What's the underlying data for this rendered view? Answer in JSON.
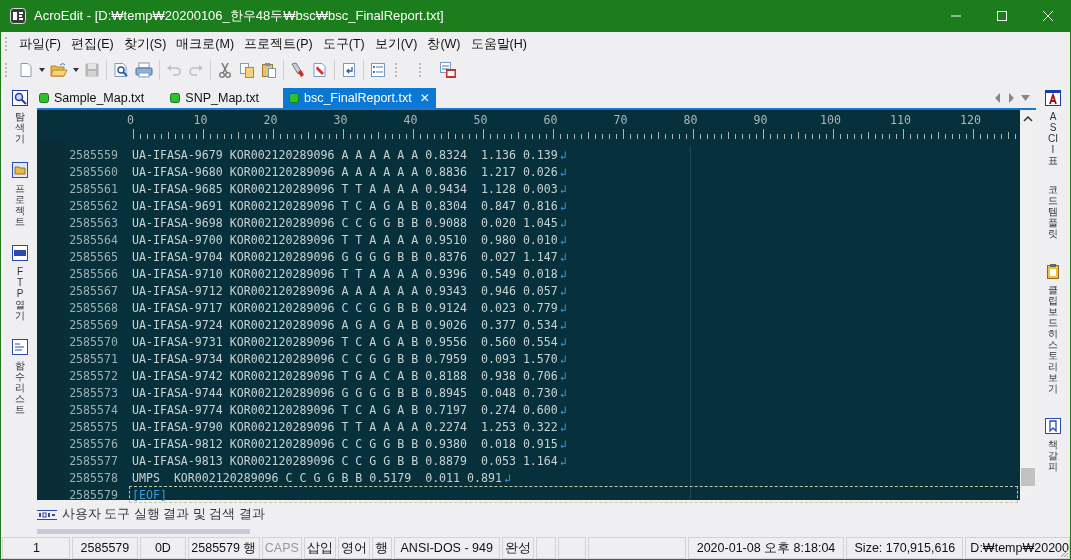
{
  "window": {
    "title": "AcroEdit - [D:₩temp₩20200106_한우48두₩bsc₩bsc_FinalReport.txt]"
  },
  "menu": [
    "파일(F)",
    "편집(E)",
    "찾기(S)",
    "매크로(M)",
    "프로젝트(P)",
    "도구(T)",
    "보기(V)",
    "창(W)",
    "도움말(H)"
  ],
  "toolbar": [
    {
      "kind": "new",
      "disabled": false
    },
    {
      "kind": "caret",
      "disabled": false
    },
    {
      "kind": "open",
      "disabled": false
    },
    {
      "kind": "caret",
      "disabled": false
    },
    {
      "kind": "save",
      "disabled": true
    },
    {
      "kind": "sep"
    },
    {
      "kind": "preview",
      "disabled": false
    },
    {
      "kind": "print",
      "disabled": false
    },
    {
      "kind": "sep"
    },
    {
      "kind": "undo",
      "disabled": true
    },
    {
      "kind": "redo",
      "disabled": true
    },
    {
      "kind": "sep"
    },
    {
      "kind": "cut",
      "disabled": false
    },
    {
      "kind": "copy",
      "disabled": false
    },
    {
      "kind": "paste",
      "disabled": false
    },
    {
      "kind": "sep"
    },
    {
      "kind": "marker",
      "disabled": false
    },
    {
      "kind": "eraser",
      "disabled": false
    },
    {
      "kind": "sep"
    },
    {
      "kind": "goto",
      "disabled": false
    },
    {
      "kind": "sep"
    },
    {
      "kind": "list",
      "disabled": false
    },
    {
      "kind": "grip"
    },
    {
      "kind": "grip"
    },
    {
      "kind": "calendar",
      "disabled": false
    }
  ],
  "left_panel": [
    {
      "kind": "search",
      "label": "탐색기"
    },
    {
      "kind": "folder",
      "label": "프로젝트"
    },
    {
      "kind": "ftp",
      "label": "FTP 열기"
    },
    {
      "kind": "chart",
      "label": "함수 리스트"
    }
  ],
  "right_panel": [
    {
      "kind": "ascii",
      "label": "ASCII 표"
    },
    {
      "kind": "none",
      "label": "코드 템플릿"
    },
    {
      "kind": "clipboard",
      "label": "클립보드 히스토리 보기"
    },
    {
      "kind": "bookmark",
      "label": "책갈피"
    }
  ],
  "tabs": [
    {
      "label": "Sample_Map.txt",
      "selected": false
    },
    {
      "label": "SNP_Map.txt",
      "selected": false
    },
    {
      "label": "bsc_FinalReport.txt",
      "selected": true,
      "close": "✕"
    }
  ],
  "ruler": [
    "0",
    "10",
    "20",
    "30",
    "40",
    "50",
    "60",
    "70",
    "80",
    "90",
    "100",
    "110",
    "120"
  ],
  "lines": [
    {
      "number": "2585559",
      "text": "UA-IFASA-9679 KOR002120289096 A A A A A A 0.8324  1.136 0.139",
      "eol": "↲",
      "current": false
    },
    {
      "number": "2585560",
      "text": "UA-IFASA-9680 KOR002120289096 A A A A A A 0.8836  1.217 0.026",
      "eol": "↲",
      "current": false
    },
    {
      "number": "2585561",
      "text": "UA-IFASA-9685 KOR002120289096 T T A A A A 0.9434  1.128 0.003",
      "eol": "↲",
      "current": false
    },
    {
      "number": "2585562",
      "text": "UA-IFASA-9691 KOR002120289096 T C A G A B 0.8304  0.847 0.816",
      "eol": "↲",
      "current": false
    },
    {
      "number": "2585563",
      "text": "UA-IFASA-9698 KOR002120289096 C C G G B B 0.9088  0.020 1.045",
      "eol": "↲",
      "current": false
    },
    {
      "number": "2585564",
      "text": "UA-IFASA-9700 KOR002120289096 T T A A A A 0.9510  0.980 0.010",
      "eol": "↲",
      "current": false
    },
    {
      "number": "2585565",
      "text": "UA-IFASA-9704 KOR002120289096 G G G G B B 0.8376  0.027 1.147",
      "eol": "↲",
      "current": false
    },
    {
      "number": "2585566",
      "text": "UA-IFASA-9710 KOR002120289096 T T A A A A 0.9396  0.549 0.018",
      "eol": "↲",
      "current": false
    },
    {
      "number": "2585567",
      "text": "UA-IFASA-9712 KOR002120289096 A A A A A A 0.9343  0.946 0.057",
      "eol": "↲",
      "current": false
    },
    {
      "number": "2585568",
      "text": "UA-IFASA-9717 KOR002120289096 C C G G B B 0.9124  0.023 0.779",
      "eol": "↲",
      "current": false
    },
    {
      "number": "2585569",
      "text": "UA-IFASA-9724 KOR002120289096 A G A G A B 0.9026  0.377 0.534",
      "eol": "↲",
      "current": false
    },
    {
      "number": "2585570",
      "text": "UA-IFASA-9731 KOR002120289096 T C A G A B 0.9556  0.560 0.554",
      "eol": "↲",
      "current": false
    },
    {
      "number": "2585571",
      "text": "UA-IFASA-9734 KOR002120289096 C C G G B B 0.7959  0.093 1.570",
      "eol": "↲",
      "current": false
    },
    {
      "number": "2585572",
      "text": "UA-IFASA-9742 KOR002120289096 T G A C A B 0.8188  0.938 0.706",
      "eol": "↲",
      "current": false
    },
    {
      "number": "2585573",
      "text": "UA-IFASA-9744 KOR002120289096 G G G G B B 0.8945  0.048 0.730",
      "eol": "↲",
      "current": false
    },
    {
      "number": "2585574",
      "text": "UA-IFASA-9774 KOR002120289096 T C A G A B 0.7197  0.274 0.600",
      "eol": "↲",
      "current": false
    },
    {
      "number": "2585575",
      "text": "UA-IFASA-9790 KOR002120289096 T T A A A A 0.2274  1.253 0.322",
      "eol": "↲",
      "current": false
    },
    {
      "number": "2585576",
      "text": "UA-IFASA-9812 KOR002120289096 C C G G B B 0.9380  0.018 0.915",
      "eol": "↲",
      "current": false
    },
    {
      "number": "2585577",
      "text": "UA-IFASA-9813 KOR002120289096 C C G G B B 0.8879  0.053 1.164",
      "eol": "↲",
      "current": false
    },
    {
      "number": "2585578",
      "text": "UMPS  KOR002120289096 C C G G B B 0.5179  0.011 0.891",
      "eol": "↲",
      "current": false
    },
    {
      "number": "2585579",
      "text": "[EOF]",
      "kind": "eof",
      "current": true
    }
  ],
  "output_panel": {
    "label": "사용자 도구 실행 결과 및 검색 결과"
  },
  "status_bar": [
    {
      "text": "1",
      "disabled": false
    },
    {
      "text": "2585579",
      "disabled": false
    },
    {
      "text": "0D",
      "disabled": false
    },
    {
      "text": "2585579 행",
      "disabled": false
    },
    {
      "text": "CAPS",
      "disabled": true
    },
    {
      "text": "삽입",
      "disabled": false
    },
    {
      "text": "영어",
      "disabled": false
    },
    {
      "text": "행",
      "disabled": false
    },
    {
      "text": "ANSI-DOS - 949",
      "disabled": false
    },
    {
      "text": "완성",
      "disabled": false
    },
    {
      "kind": "blank"
    },
    {
      "kind": "blank"
    },
    {
      "kind": "blank"
    },
    {
      "text": "2020-01-08 오후 8:18:04",
      "disabled": false
    },
    {
      "text": "Size: 170,915,616",
      "disabled": false
    },
    {
      "text": "D:₩temp₩20200",
      "disabled": false
    }
  ]
}
